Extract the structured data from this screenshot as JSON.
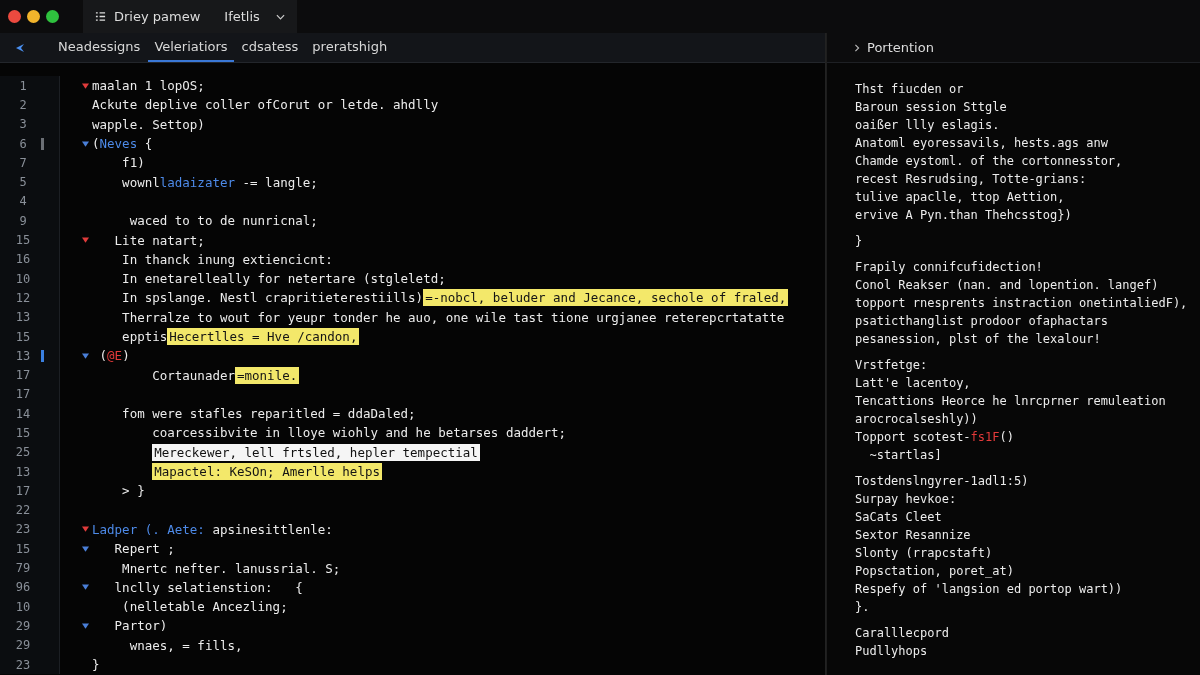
{
  "window": {
    "tabs": [
      {
        "label": "Driey pamew"
      },
      {
        "label": "Ifetlis"
      }
    ]
  },
  "editor_tabs": [
    {
      "label": "Neadessigns",
      "selected": false
    },
    {
      "label": "Veleriatiors",
      "selected": true
    },
    {
      "label": "cdsatess",
      "selected": false
    },
    {
      "label": "preratshigh",
      "selected": false
    }
  ],
  "code_lines": [
    {
      "number": "1",
      "fold": {
        "color": "#e03b3b"
      },
      "segments": [
        {
          "text": "maalan 1 lopOS;",
          "kind": "plain"
        }
      ]
    },
    {
      "number": "2",
      "segments": [
        {
          "text": "Ackute deplive coller ofCorut or letde. ahdlly",
          "kind": "plain"
        }
      ]
    },
    {
      "number": "3",
      "segments": [
        {
          "text": "wapple. Settop)",
          "kind": "plain"
        }
      ]
    },
    {
      "number": "6",
      "gutter": {
        "color": "#6b6f75"
      },
      "fold": {
        "color": "#4a7fd8"
      },
      "segments": [
        {
          "text": "(",
          "kind": "plain"
        },
        {
          "text": "Neves",
          "kind": "keyword"
        },
        {
          "text": " {",
          "kind": "plain"
        }
      ]
    },
    {
      "number": "7",
      "segments": [
        {
          "text": "    f1)",
          "kind": "plain"
        }
      ]
    },
    {
      "number": "5",
      "segments": [
        {
          "text": "    wownl",
          "kind": "plain"
        },
        {
          "text": "ladaizater",
          "kind": "keyword"
        },
        {
          "text": " -= langle;",
          "kind": "plain"
        }
      ]
    },
    {
      "number": "4"
    },
    {
      "number": "9",
      "segments": [
        {
          "text": "     waced to to de nunricnal;",
          "kind": "plain"
        }
      ]
    },
    {
      "number": "15",
      "fold": {
        "color": "#e03b3b"
      },
      "segments": [
        {
          "text": "   Lite natart;",
          "kind": "plain"
        }
      ]
    },
    {
      "number": "16",
      "segments": [
        {
          "text": "    In thanck inung extiencicnt:",
          "kind": "plain"
        }
      ]
    },
    {
      "number": "10",
      "segments": [
        {
          "text": "    In enetarelleally for netertare (stgleletd;",
          "kind": "plain"
        }
      ]
    },
    {
      "number": "12",
      "segments": [
        {
          "text": "    In spslange. Nestl crapritieterestiills)",
          "kind": "plain"
        },
        {
          "text": "=-nobcl, beluder and Jecance, sechole of fraled,",
          "kind": "highlight"
        }
      ]
    },
    {
      "number": "13",
      "segments": [
        {
          "text": "    Therralze to wout for yeupr tonder he auo, one wile tast tione urgjanee reterepcrtatatte",
          "kind": "plain"
        }
      ]
    },
    {
      "number": "15",
      "segments": [
        {
          "text": "    epptis",
          "kind": "plain"
        },
        {
          "text": "Hecertlles = Hve /candon,",
          "kind": "highlight"
        }
      ]
    },
    {
      "number": "13",
      "gutter": {
        "color": "#3a7fe0"
      },
      "fold": {
        "color": "#4a7fd8"
      },
      "segments": [
        {
          "text": " (",
          "kind": "plain"
        },
        {
          "text": "@E",
          "kind": "accent"
        },
        {
          "text": ")",
          "kind": "plain"
        }
      ]
    },
    {
      "number": "17",
      "segments": [
        {
          "text": "        Cortaunader",
          "kind": "plain"
        },
        {
          "text": "=monile.",
          "kind": "highlight"
        }
      ]
    },
    {
      "number": "17"
    },
    {
      "number": "14",
      "segments": [
        {
          "text": "    fom were stafles reparitled = ddaDaled;",
          "kind": "plain"
        }
      ]
    },
    {
      "number": "15",
      "segments": [
        {
          "text": "        coarcessibvite in lloye wiohly and he betarses daddert;",
          "kind": "plain"
        }
      ]
    },
    {
      "number": "25",
      "segments": [
        {
          "text": "Mereckewer, lell frtsled, hepler tempectial",
          "kind": "selection"
        }
      ]
    },
    {
      "number": "13",
      "segments": [
        {
          "text": "Mapactel: KeSOn; Amerlle helps",
          "kind": "highlight"
        }
      ]
    },
    {
      "number": "17",
      "segments": [
        {
          "text": "    > }",
          "kind": "plain"
        }
      ]
    },
    {
      "number": "22"
    },
    {
      "number": "23",
      "fold": {
        "color": "#e03b3b"
      },
      "segments": [
        {
          "text": "Lаdper (. Aete:",
          "kind": "keyword"
        },
        {
          "text": " apsinesittlenle:",
          "kind": "plain"
        }
      ]
    },
    {
      "number": "15",
      "fold": {
        "color": "#4a7fd8"
      },
      "segments": [
        {
          "text": "   Repert ;",
          "kind": "plain"
        }
      ]
    },
    {
      "number": "79",
      "segments": [
        {
          "text": "    Mnertc nefter. lanussrial. S;",
          "kind": "plain"
        }
      ]
    },
    {
      "number": "96",
      "fold": {
        "color": "#4a7fd8"
      },
      "segments": [
        {
          "text": "   lnclly selatienstion:   {",
          "kind": "plain"
        }
      ]
    },
    {
      "number": "10",
      "segments": [
        {
          "text": "    (nelletable Ancezling;",
          "kind": "plain"
        }
      ]
    },
    {
      "number": "29",
      "fold": {
        "color": "#4a7fd8"
      },
      "segments": [
        {
          "text": "   Partor)",
          "kind": "plain"
        }
      ]
    },
    {
      "number": "29",
      "segments": [
        {
          "text": "     wnaes, = fills,",
          "kind": "plain"
        }
      ]
    },
    {
      "number": "23",
      "segments": [
        {
          "text": "}",
          "kind": "plain"
        }
      ]
    }
  ],
  "panel": {
    "title": "Portention",
    "groups": [
      [
        [
          {
            "text": "Thst fiucden or",
            "kind": "plain"
          }
        ],
        [
          {
            "text": "Baroun session Sttgle",
            "kind": "plain"
          }
        ],
        [
          {
            "text": "oaißer llly eslagis.",
            "kind": "plain"
          }
        ],
        [
          {
            "text": "Anatoml eyoressavils, hests.ags anw",
            "kind": "plain"
          }
        ],
        [
          {
            "text": "Chamde eystoml. of the cortonnesstor,",
            "kind": "plain"
          }
        ],
        [
          {
            "text": "recest Resrudsing, Totte-grians:",
            "kind": "plain"
          }
        ],
        [
          {
            "text": "tulive apaclle, ttop Aettion,",
            "kind": "plain"
          }
        ],
        [
          {
            "text": "ervive A Pyn.than Thehcsstog})",
            "kind": "plain"
          }
        ]
      ],
      [
        [
          {
            "text": "}",
            "kind": "plain"
          }
        ]
      ],
      [
        [
          {
            "text": "Frapily connifcufidection!",
            "kind": "plain"
          }
        ],
        [
          {
            "text": "Conol Reakser (nan. and lopention. langef)",
            "kind": "plain"
          }
        ],
        [
          {
            "text": "topport rnesprents instraction onetintaliedF),",
            "kind": "plain"
          }
        ],
        [
          {
            "text": "psaticthanglist prodoor ofaphactars",
            "kind": "plain"
          }
        ],
        [
          {
            "text": "pesanession, plst of the lexalour!",
            "kind": "plain"
          }
        ]
      ],
      [
        [
          {
            "text": "Vrstfetge:",
            "kind": "plain"
          }
        ],
        [
          {
            "text": "Latt'e lacentoy,",
            "kind": "plain"
          }
        ],
        [
          {
            "text": "Tencattions Heorce he lnrcprner remuleation",
            "kind": "plain"
          }
        ],
        [
          {
            "text": "arocrocalseshly))",
            "kind": "plain"
          }
        ],
        [
          {
            "text": "Topport scotest-",
            "kind": "plain"
          },
          {
            "text": "fs1F",
            "kind": "accent"
          },
          {
            "text": "()",
            "kind": "plain"
          }
        ],
        [
          {
            "text": "  ~startlas]",
            "kind": "plain"
          }
        ]
      ],
      [
        [
          {
            "text": "Tostdenslngyrer-1adl1:5)",
            "kind": "plain"
          }
        ],
        [
          {
            "text": "Surpay hevkoe:",
            "kind": "plain"
          }
        ],
        [
          {
            "text": "SaCats Cleet",
            "kind": "plain"
          }
        ],
        [
          {
            "text": "Sextor Resannize",
            "kind": "plain"
          }
        ],
        [
          {
            "text": "Slonty (rrapcstaft)",
            "kind": "plain"
          }
        ],
        [
          {
            "text": "Popsctation, poret_at)",
            "kind": "plain"
          }
        ],
        [
          {
            "text": "Respefy of 'langsion ed portop wart))",
            "kind": "plain"
          }
        ],
        [
          {
            "text": "}.",
            "kind": "plain"
          }
        ]
      ],
      [
        [
          {
            "text": "Caralllecpord",
            "kind": "plain"
          }
        ],
        [
          {
            "text": "Pudllyhops",
            "kind": "plain"
          }
        ]
      ]
    ]
  }
}
